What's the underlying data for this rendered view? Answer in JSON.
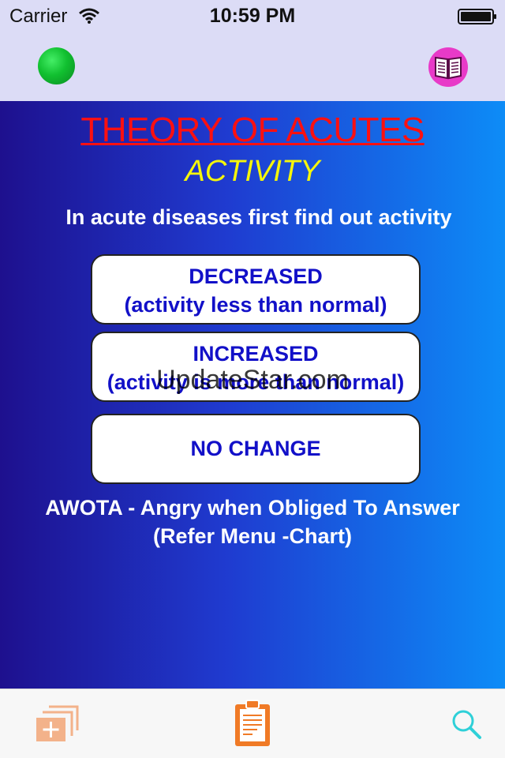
{
  "status_bar": {
    "carrier": "Carrier",
    "time": "10:59 PM"
  },
  "header": {
    "left_indicator_icon": "green-dot-icon",
    "right_button_icon": "book-icon"
  },
  "main": {
    "title": "THEORY OF ACUTES",
    "subtitle": "ACTIVITY",
    "intro": "In acute diseases first find out activity",
    "options": [
      {
        "label": "DECREASED",
        "detail": "(activity less than normal)"
      },
      {
        "label": "INCREASED",
        "detail": "(activity is more than normal)"
      },
      {
        "label": "NO CHANGE"
      }
    ],
    "watermark": "UpdateStar.com",
    "note": "AWOTA - Angry when Obliged To Answer",
    "note_ref": "(Refer Menu -Chart)"
  },
  "tab_bar": {
    "items": [
      {
        "icon": "add-stack-icon"
      },
      {
        "icon": "clipboard-icon"
      },
      {
        "icon": "search-icon"
      }
    ]
  },
  "colors": {
    "title": "#ff1010",
    "subtitle": "#f6f60a",
    "option_text": "#1210c8",
    "gradient_start": "#1e108e",
    "gradient_end": "#0d8cf7",
    "tab_icon_orange": "#f07a26",
    "search_icon": "#2fd0d8"
  }
}
